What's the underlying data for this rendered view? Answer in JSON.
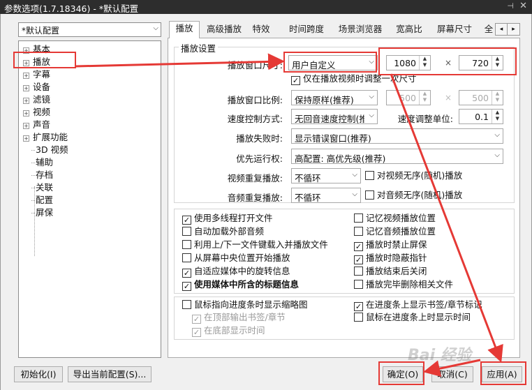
{
  "window": {
    "title": "参数选项(1.7.18346) - *默认配置",
    "pin_icon": "pin-icon",
    "close_icon": "close-icon"
  },
  "sidebar": {
    "profile": "*默认配置",
    "tree": [
      {
        "label": "基本",
        "expandable": true
      },
      {
        "label": "播放",
        "expandable": true
      },
      {
        "label": "字幕",
        "expandable": true
      },
      {
        "label": "设备",
        "expandable": true
      },
      {
        "label": "滤镜",
        "expandable": true
      },
      {
        "label": "视频",
        "expandable": true
      },
      {
        "label": "声音",
        "expandable": true
      },
      {
        "label": "扩展功能",
        "expandable": true
      },
      {
        "label": "3D 视频",
        "expandable": false
      },
      {
        "label": "辅助",
        "expandable": false
      },
      {
        "label": "存档",
        "expandable": false
      },
      {
        "label": "关联",
        "expandable": false
      },
      {
        "label": "配置",
        "expandable": false
      },
      {
        "label": "屏保",
        "expandable": false
      }
    ]
  },
  "tabs": [
    "播放",
    "高级播放",
    "特效",
    "时间跨度",
    "场景浏览器",
    "宽高比",
    "屏幕尺寸",
    "全"
  ],
  "tab_scroll": {
    "left": "◂",
    "right": "▸"
  },
  "playback": {
    "group_title": "播放设置",
    "window_size_label": "播放窗口尺寸:",
    "window_size_value": "用户自定义",
    "width": "1080",
    "height": "720",
    "times": "×",
    "adjust_once_label": "仅在播放视频时调整一次尺寸",
    "ratio_label": "播放窗口比例:",
    "ratio_value": "保持原样(推荐)",
    "ratio_w": "500",
    "ratio_h": "500",
    "speed_label": "速度控制方式:",
    "speed_value": "无回音速度控制(推",
    "speed_unit_label": "速度调整单位:",
    "speed_unit_value": "0.1",
    "fail_label": "播放失败时:",
    "fail_value": "显示错误窗口(推荐)",
    "priority_label": "优先运行权:",
    "priority_value": "高配置: 高优先级(推荐)",
    "video_repeat_label": "视频重复播放:",
    "video_repeat_value": "不循环",
    "video_random_label": "对视频无序(随机)播放",
    "audio_repeat_label": "音频重复播放:",
    "audio_repeat_value": "不循环",
    "audio_random_label": "对音频无序(随机)播放"
  },
  "options_left": [
    {
      "label": "使用多线程打开文件",
      "checked": true
    },
    {
      "label": "自动加载外部音频",
      "checked": false
    },
    {
      "label": "利用上/下一文件键载入并播放文件",
      "checked": false
    },
    {
      "label": "从屏幕中央位置开始播放",
      "checked": false
    },
    {
      "label": "自适应媒体中的旋转信息",
      "checked": true
    },
    {
      "label": "使用媒体中所含的标题信息",
      "checked": true
    }
  ],
  "options_right": [
    {
      "label": "记忆视频播放位置",
      "checked": false
    },
    {
      "label": "记忆音频播放位置",
      "checked": false
    },
    {
      "label": "播放时禁止屏保",
      "checked": true
    },
    {
      "label": "播放时隐蔽指针",
      "checked": true
    },
    {
      "label": "播放结束后关闭",
      "checked": false
    },
    {
      "label": "播放完毕删除相关文件",
      "checked": false
    }
  ],
  "seekbar": {
    "thumbnail_label": "鼠标指向进度条时显示缩略图",
    "top_bookmark_label": "在顶部输出书签/章节",
    "bottom_time_label": "在底部显示时间",
    "show_bookmarks_label": "在进度条上显示书签/章节标记",
    "show_time_label": "鼠标在进度条上时显示时间"
  },
  "buttons": {
    "init": "初始化(I)",
    "export": "导出当前配置(S)...",
    "ok": "确定(O)",
    "cancel": "取消(C)",
    "apply": "应用(A)"
  },
  "watermark": "Bai 经验",
  "colors": {
    "annotation": "#e53935",
    "titlebar": "#2d2d2d",
    "window": "#f0f0f0"
  }
}
